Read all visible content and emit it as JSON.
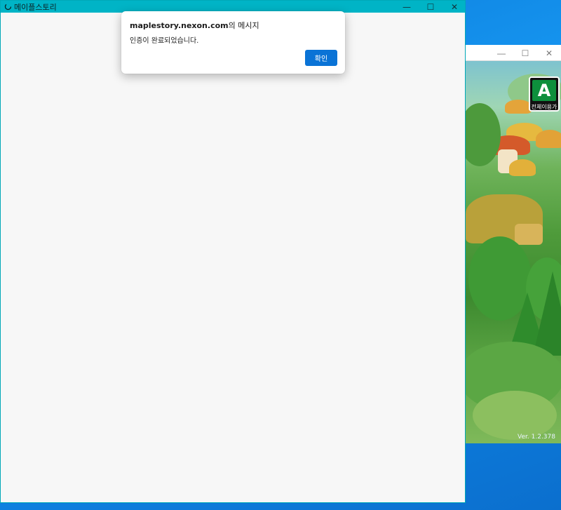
{
  "main_window": {
    "title": "메이플스토리",
    "controls": {
      "minimize_icon": "minimize-icon",
      "maximize_icon": "maximize-icon",
      "close_icon": "close-icon",
      "minimize_glyph": "—",
      "maximize_glyph": "☐",
      "close_glyph": "✕"
    },
    "accent_color": "#00b4c6"
  },
  "dialog": {
    "origin": "maplestory.nexon.com",
    "title_suffix": "의 메시지",
    "message": "인증이 완료되었습니다.",
    "ok_label": "확인",
    "button_color": "#0a73d6"
  },
  "launcher": {
    "controls": {
      "minimize_glyph": "—",
      "maximize_glyph": "☐",
      "close_glyph": "✕"
    },
    "rating_badge_label": "전체이용가",
    "rating_badge_mark": "A",
    "version": "Ver. 1.2.378"
  }
}
